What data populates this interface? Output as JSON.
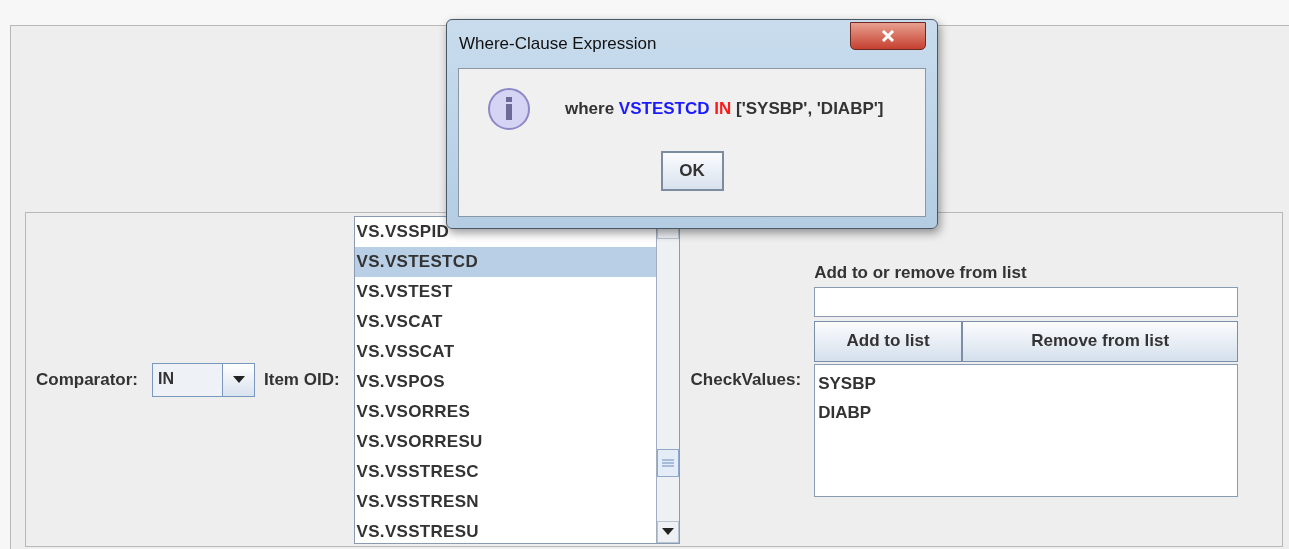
{
  "dialog": {
    "title": "Where-Clause Expression",
    "message": [
      {
        "text": "where",
        "color": "#333333"
      },
      {
        "text": "VSTESTCD",
        "color": "#1a1aff"
      },
      {
        "text": "IN",
        "color": "#ff1a1a"
      },
      {
        "text": "['SYSBP', 'DIABP']",
        "color": "#333333"
      }
    ],
    "button": "OK"
  },
  "comparator": {
    "label": "Comparator:",
    "value": "IN"
  },
  "item_oid": {
    "label": "Item OID:",
    "items": [
      {
        "label": "VS.VSSPID",
        "selected": false
      },
      {
        "label": "VS.VSTESTCD",
        "selected": true
      },
      {
        "label": "VS.VSTEST",
        "selected": false
      },
      {
        "label": "VS.VSCAT",
        "selected": false
      },
      {
        "label": "VS.VSSCAT",
        "selected": false
      },
      {
        "label": "VS.VSPOS",
        "selected": false
      },
      {
        "label": "VS.VSORRES",
        "selected": false
      },
      {
        "label": "VS.VSORRESU",
        "selected": false
      },
      {
        "label": "VS.VSSTRESC",
        "selected": false
      },
      {
        "label": "VS.VSSTRESN",
        "selected": false
      },
      {
        "label": "VS.VSSTRESU",
        "selected": false
      }
    ]
  },
  "check_values": {
    "label": "CheckValues:",
    "hint": "Add to or remove from list",
    "add_button": "Add to list",
    "remove_button": "Remove from list",
    "values": [
      "SYSBP",
      "DIABP"
    ]
  }
}
